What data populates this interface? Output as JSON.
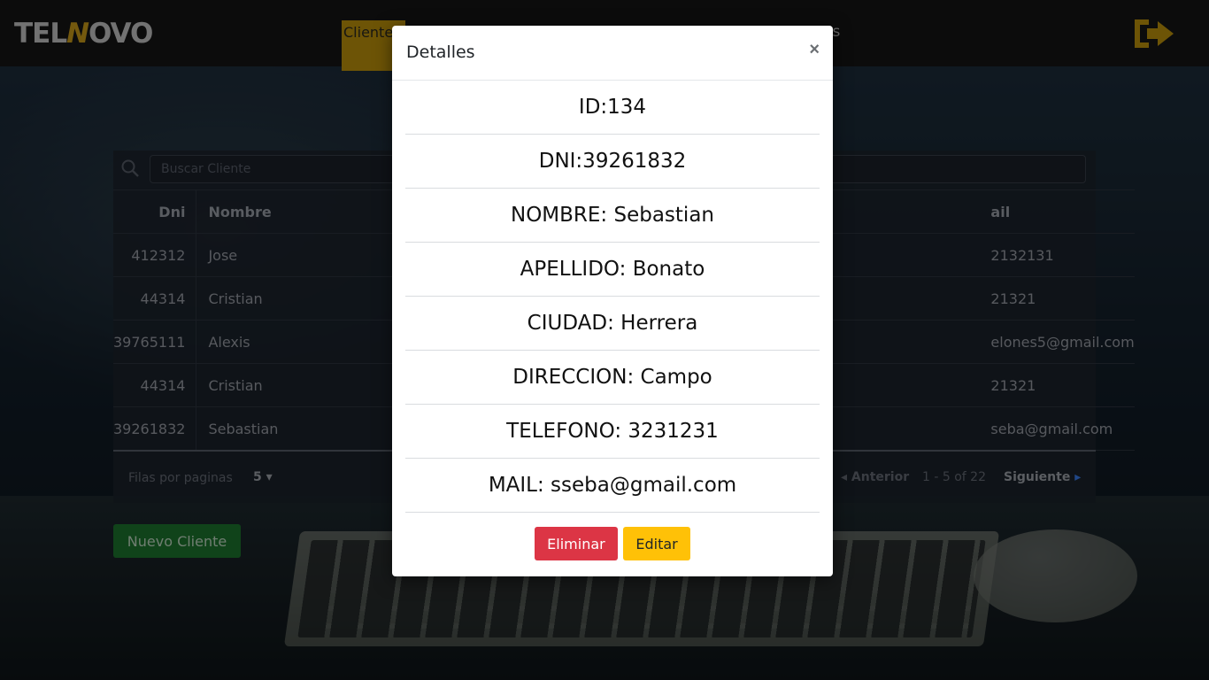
{
  "brand": {
    "logo_left": "TEL",
    "logo_n": "N",
    "logo_right": "OVO",
    "accent_color": "#d4a21a"
  },
  "nav": {
    "active_item": "Clientes",
    "right_item_visible": "es",
    "logout_icon": "logout-icon"
  },
  "search": {
    "placeholder": "Buscar Cliente",
    "icon": "search-icon"
  },
  "table": {
    "headers": {
      "dni": "Dni",
      "nombre": "Nombre",
      "mail": "ail"
    },
    "rows": [
      {
        "dni": "412312",
        "nombre": "Jose",
        "mail": "2132131"
      },
      {
        "dni": "44314",
        "nombre": "Cristian",
        "mail": "21321"
      },
      {
        "dni": "39765111",
        "nombre": "Alexis",
        "mail": "elones5@gmail.com"
      },
      {
        "dni": "44314",
        "nombre": "Cristian",
        "mail": "21321"
      },
      {
        "dni": "39261832",
        "nombre": "Sebastian",
        "mail": "seba@gmail.com"
      }
    ]
  },
  "pagination": {
    "rows_label": "Filas por paginas",
    "rows_value": "5 ▾",
    "prev_label": "Anterior",
    "range": "1 - 5 of 22",
    "next_label": "Siguiente"
  },
  "new_client_label": "Nuevo Cliente",
  "modal": {
    "title": "Detalles",
    "close": "×",
    "details": [
      "ID:134",
      "DNI:39261832",
      "NOMBRE: Sebastian",
      "APELLIDO: Bonato",
      "CIUDAD: Herrera",
      "DIRECCION: Campo",
      "TELEFONO: 3231231",
      "MAIL: sseba@gmail.com"
    ],
    "delete_label": "Eliminar",
    "edit_label": "Editar",
    "delete_color": "#dc3545",
    "edit_color": "#ffc107"
  }
}
